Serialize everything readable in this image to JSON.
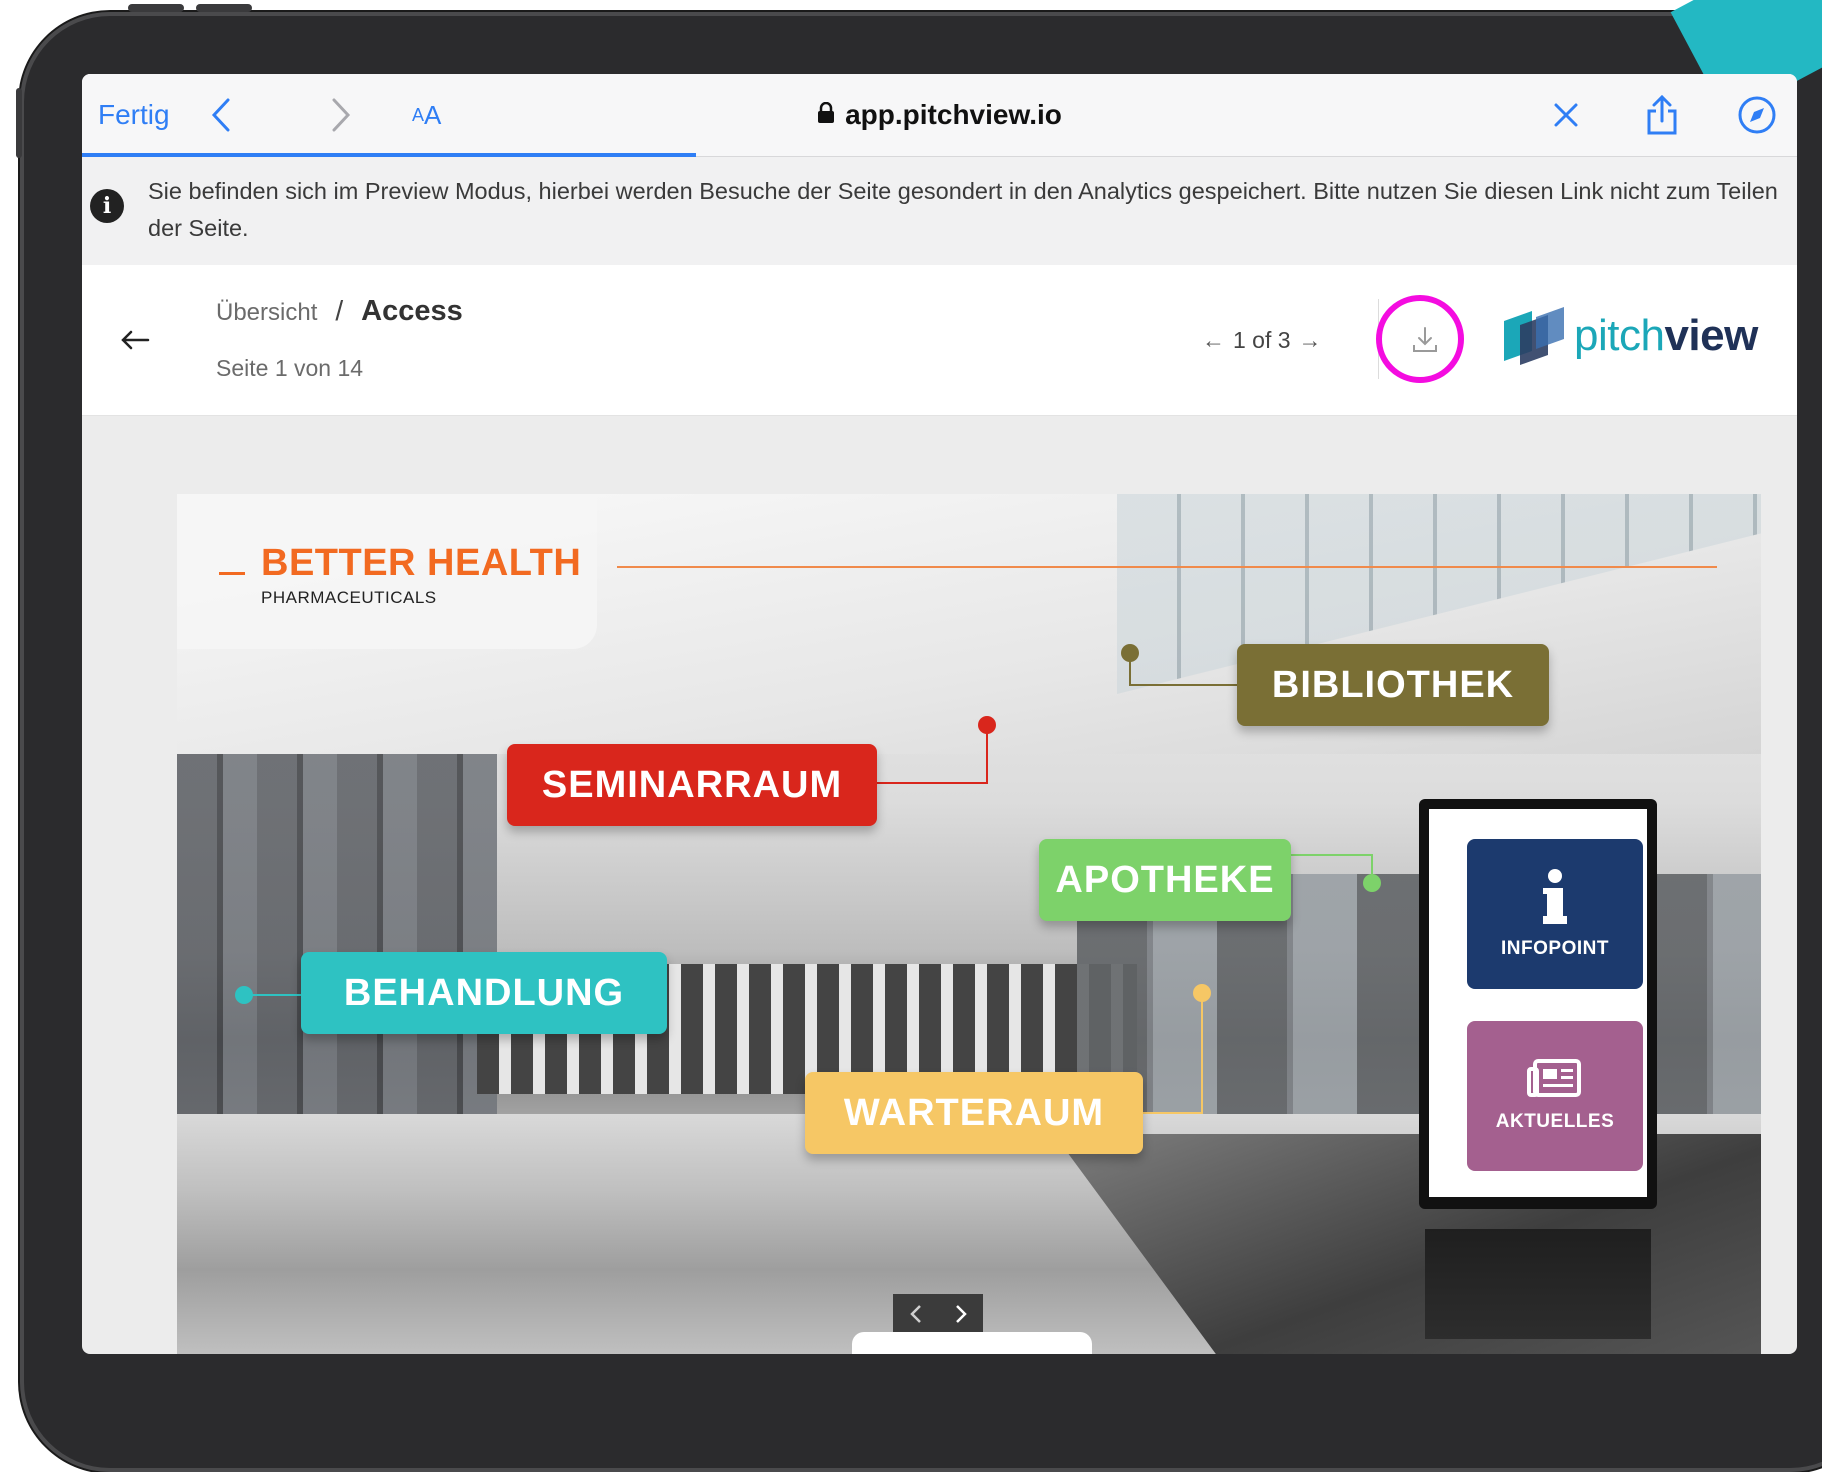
{
  "browser": {
    "done_label": "Fertig",
    "text_size_label_small": "A",
    "text_size_label_large": "A",
    "url": "app.pitchview.io",
    "accent_color": "#2f7ef5"
  },
  "notice": {
    "text": "Sie befinden sich im Preview Modus, hierbei werden Besuche der Seite gesondert in den Analytics gespeichert. Bitte nutzen Sie diesen Link nicht zum Teilen der Seite."
  },
  "header": {
    "breadcrumb_parent": "Übersicht",
    "breadcrumb_separator": "/",
    "breadcrumb_current": "Access",
    "page_info": "Seite 1 von 14",
    "pager_text": "1 of 3",
    "highlight_color": "#f40ce0",
    "logo_text_a": "pitch",
    "logo_text_b": "view"
  },
  "slide": {
    "brand_title": "BETTER HEALTH",
    "brand_subtitle": "PHARMACEUTICALS",
    "hotspots": {
      "bibliothek": {
        "label": "BIBLIOTHEK",
        "color": "#7a6f35"
      },
      "seminarraum": {
        "label": "SEMINARRAUM",
        "color": "#d9261c"
      },
      "apotheke": {
        "label": "APOTHEKE",
        "color": "#7dd26a"
      },
      "behandlung": {
        "label": "BEHANDLUNG",
        "color": "#2ec2c2"
      },
      "warteraum": {
        "label": "WARTERAUM",
        "color": "#f6c765"
      }
    },
    "kiosk": {
      "infopoint_label": "INFOPOINT",
      "infopoint_color": "#1c3a6e",
      "aktuelles_label": "AKTUELLES",
      "aktuelles_color": "#a4608f"
    }
  }
}
